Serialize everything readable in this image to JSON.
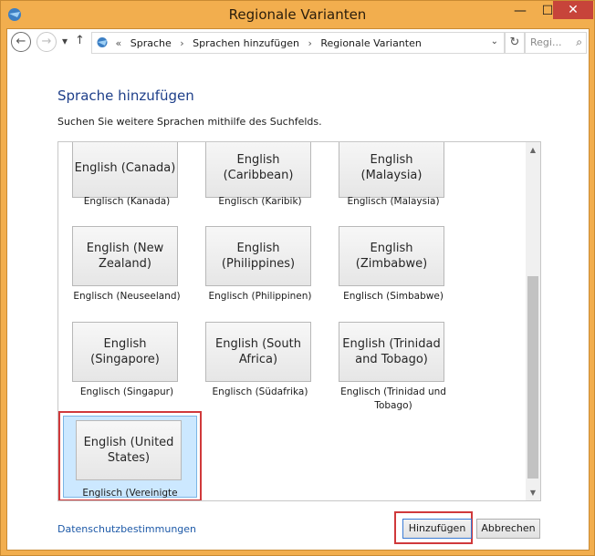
{
  "window": {
    "title": "Regionale Varianten",
    "minimize_glyph": "—",
    "maximize_glyph": "☐",
    "close_glyph": "✕"
  },
  "addressbar": {
    "back_glyph": "←",
    "forward_glyph": "→",
    "history_glyph": "▾",
    "up_glyph": "↑",
    "overflow_glyph": "«",
    "breadcrumbs": [
      "Sprache",
      "Sprachen hinzufügen",
      "Regionale Varianten"
    ],
    "separator": "›",
    "dropdown_glyph": "⌄",
    "refresh_glyph": "↻",
    "search_placeholder": "Regi...",
    "search_glyph": "⌕"
  },
  "heading": "Sprache hinzufügen",
  "hint": "Suchen Sie weitere Sprachen mithilfe des Suchfelds.",
  "languages": [
    {
      "name": "English (Canada)",
      "caption": "Englisch (Kanada)"
    },
    {
      "name": "English (Caribbean)",
      "caption": "Englisch (Karibik)"
    },
    {
      "name": "English (Malaysia)",
      "caption": "Englisch (Malaysia)"
    },
    {
      "name": "English (New Zealand)",
      "caption": "Englisch (Neuseeland)"
    },
    {
      "name": "English (Philippines)",
      "caption": "Englisch (Philippinen)"
    },
    {
      "name": "English (Zimbabwe)",
      "caption": "Englisch (Simbabwe)"
    },
    {
      "name": "English (Singapore)",
      "caption": "Englisch (Singapur)"
    },
    {
      "name": "English (South Africa)",
      "caption": "Englisch (Südafrika)"
    },
    {
      "name": "English (Trinidad and Tobago)",
      "caption": "Englisch (Trinidad und Tobago)"
    },
    {
      "name": "English (United States)",
      "caption": "Englisch (Vereinigte Staaten)"
    }
  ],
  "selected_language": "English (United States)",
  "scrollbar": {
    "up_glyph": "▲",
    "down_glyph": "▼"
  },
  "footer": {
    "privacy_link": "Datenschutzbestimmungen",
    "add_button": "Hinzufügen",
    "cancel_button": "Abbrechen"
  },
  "colors": {
    "frame": "#f2ae4e",
    "heading": "#1e3f8a",
    "selection": "#cce8ff",
    "highlight_box": "#d0393b",
    "link": "#1e5aa8"
  }
}
